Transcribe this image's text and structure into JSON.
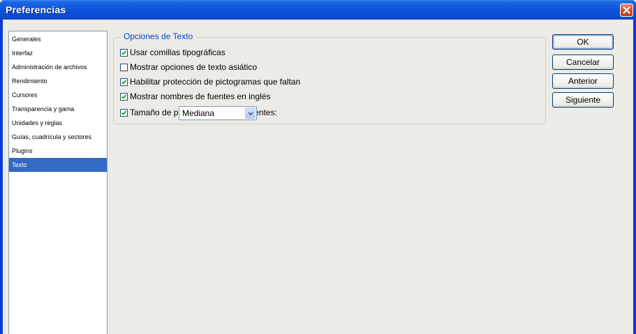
{
  "window": {
    "title": "Preferencias"
  },
  "sidebar": {
    "items": [
      {
        "label": "Generales",
        "selected": false
      },
      {
        "label": "Interfaz",
        "selected": false
      },
      {
        "label": "Administración de archivos",
        "selected": false
      },
      {
        "label": "Rendimiento",
        "selected": false
      },
      {
        "label": "Cursores",
        "selected": false
      },
      {
        "label": "Transparencia y gama",
        "selected": false
      },
      {
        "label": "Unidades y reglas",
        "selected": false
      },
      {
        "label": "Guías, cuadrícula y sectores",
        "selected": false
      },
      {
        "label": "Plugins",
        "selected": false
      },
      {
        "label": "Texto",
        "selected": true
      }
    ]
  },
  "text_options": {
    "group_title": "Opciones de Texto",
    "options": [
      {
        "label": "Usar comillas tipográficas",
        "checked": true
      },
      {
        "label": "Mostrar opciones de texto asiático",
        "checked": false
      },
      {
        "label": "Habilitar protección de pictogramas que faltan",
        "checked": true
      },
      {
        "label": "Mostrar nombres de fuentes en inglés",
        "checked": true
      },
      {
        "label": "Tamaño de previsualización de fuentes:",
        "checked": true
      }
    ],
    "font_preview_size": {
      "value": "Mediana"
    }
  },
  "buttons": {
    "ok": "OK",
    "cancel": "Cancelar",
    "previous": "Anterior",
    "next": "Siguiente"
  },
  "colors": {
    "title_bar": "#0a54dc",
    "selection": "#316ac5",
    "group_title": "#0046d5",
    "close_button": "#d44a26"
  }
}
